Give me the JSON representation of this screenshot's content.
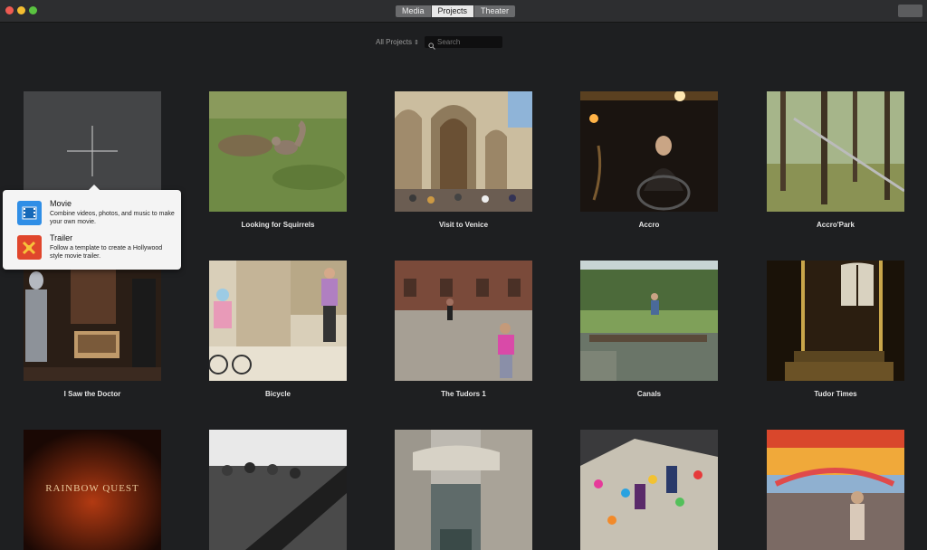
{
  "titlebar": {
    "tabs": [
      "Media",
      "Projects",
      "Theater"
    ],
    "active_tab": "Projects"
  },
  "toolbar": {
    "filter_label": "All Projects",
    "search_placeholder": "Search"
  },
  "new_project_popup": {
    "items": [
      {
        "title": "Movie",
        "description": "Combine videos, photos, and music to make your own movie.",
        "icon": "movie-film-icon",
        "color": "#2f8ee6"
      },
      {
        "title": "Trailer",
        "description": "Follow a template to create a Hollywood style movie trailer.",
        "icon": "trailer-clapper-icon",
        "color": "#e0462c"
      }
    ]
  },
  "projects": [
    {
      "title": "Looking for Squirrels"
    },
    {
      "title": "Visit to Venice"
    },
    {
      "title": "Accro"
    },
    {
      "title": "Accro'Park"
    },
    {
      "title": "I Saw the Doctor"
    },
    {
      "title": "Bicycle"
    },
    {
      "title": "The Tudors 1"
    },
    {
      "title": "Canals"
    },
    {
      "title": "Tudor Times"
    },
    {
      "title": "",
      "overlay_text": "RAINBOW QUEST"
    },
    {
      "title": ""
    },
    {
      "title": ""
    },
    {
      "title": ""
    },
    {
      "title": ""
    }
  ],
  "colors": {
    "background": "#1e1f21",
    "titlebar": "#2d2e30",
    "accent_movie": "#2f8ee6",
    "accent_trailer": "#e0462c"
  }
}
